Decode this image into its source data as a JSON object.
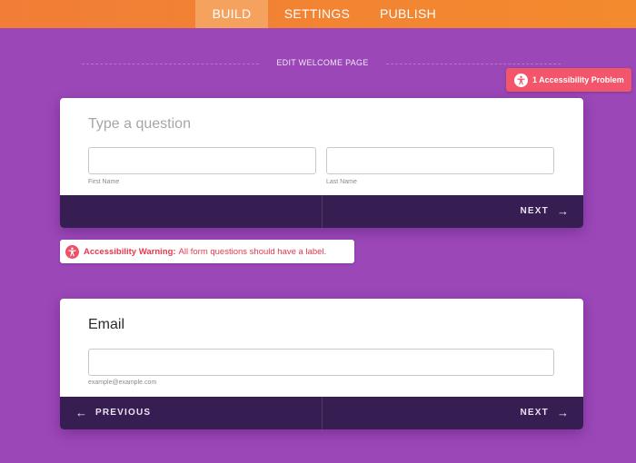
{
  "nav": {
    "tabs": [
      {
        "label": "BUILD",
        "active": true
      },
      {
        "label": "SETTINGS",
        "active": false
      },
      {
        "label": "PUBLISH",
        "active": false
      }
    ]
  },
  "edit_section_label": "EDIT WELCOME PAGE",
  "accessibility_badge": {
    "text": "1 Accessibility Problem",
    "icon": "accessibility-icon",
    "color": "#f3566b"
  },
  "question1": {
    "placeholder": "Type a question",
    "fields": [
      {
        "label": "First Name",
        "value": ""
      },
      {
        "label": "Last Name",
        "value": ""
      }
    ],
    "next_label": "NEXT"
  },
  "warning": {
    "title": "Accessibility Warning:",
    "message": "All form questions should have a label.",
    "icon": "accessibility-icon"
  },
  "question2": {
    "title": "Email",
    "field": {
      "label": "example@example.com",
      "value": ""
    },
    "previous_label": "PREVIOUS",
    "next_label": "NEXT"
  },
  "colors": {
    "background": "#9b47b8",
    "topbar": "#f27d37",
    "footer": "#371e52",
    "warning": "#e8374f"
  }
}
